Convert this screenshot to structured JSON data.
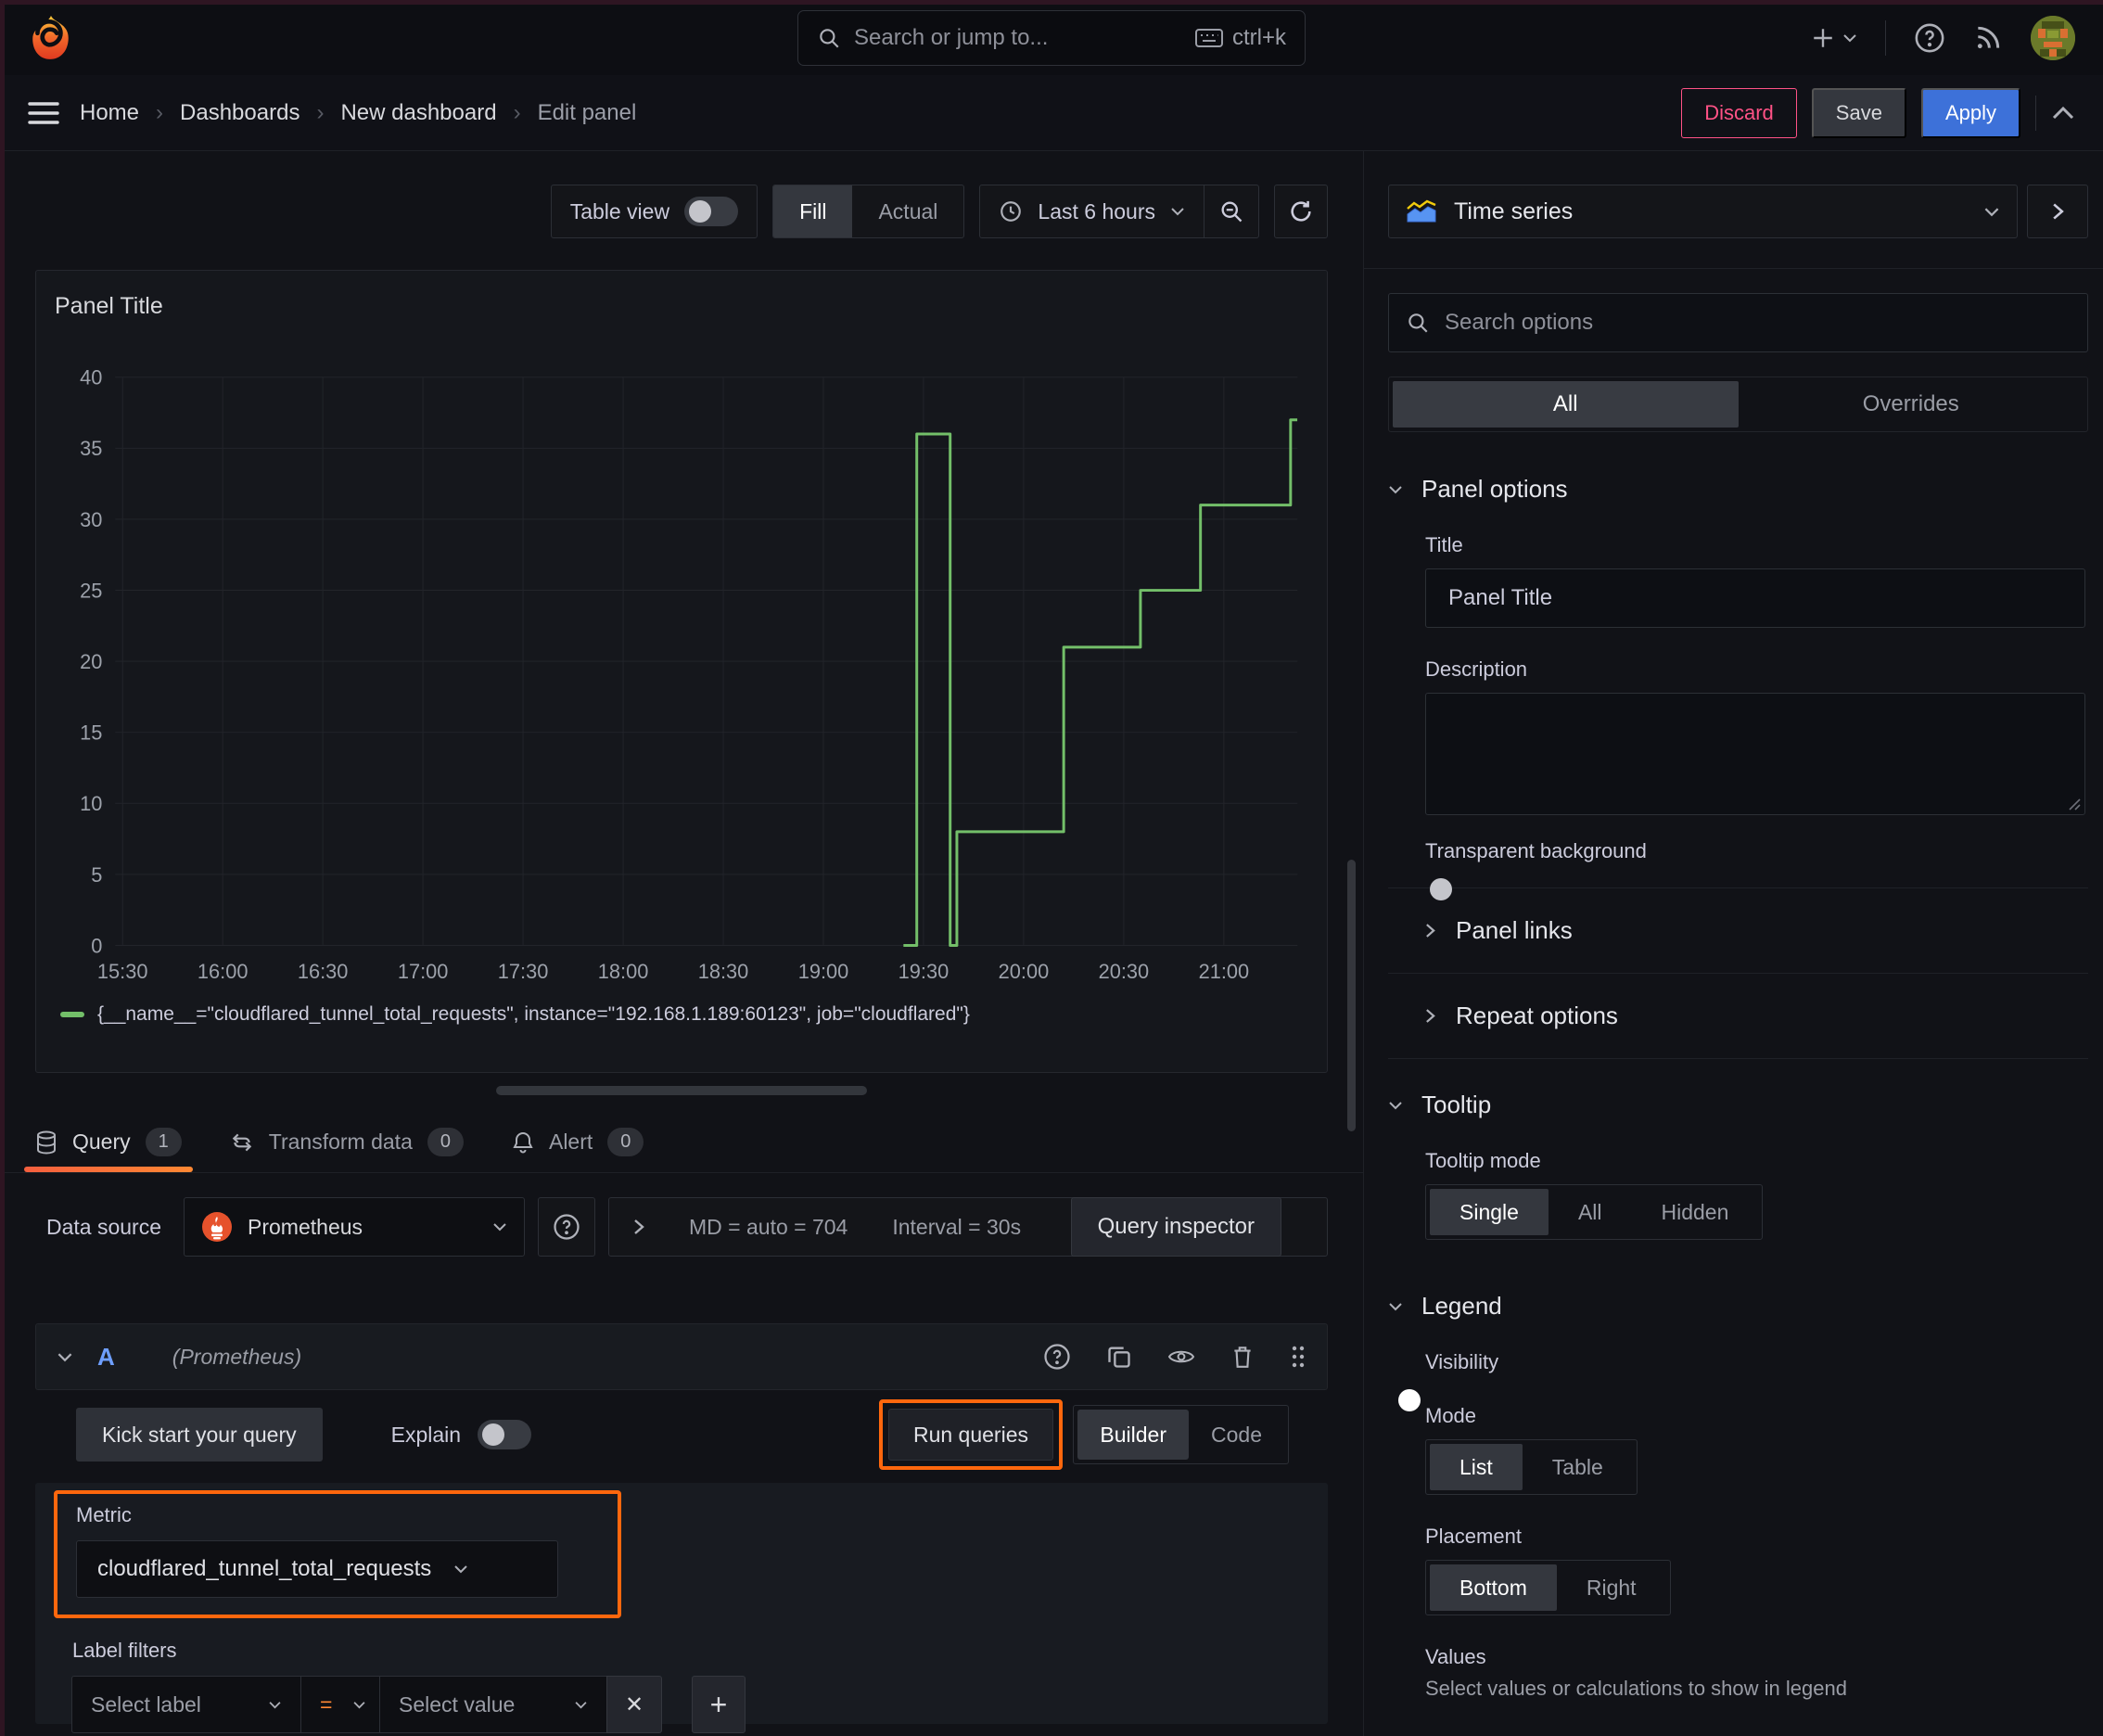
{
  "topbar": {
    "search_placeholder": "Search or jump to...",
    "search_shortcut": "ctrl+k"
  },
  "breadcrumb": {
    "items": [
      "Home",
      "Dashboards",
      "New dashboard",
      "Edit panel"
    ],
    "discard_label": "Discard",
    "save_label": "Save",
    "apply_label": "Apply"
  },
  "panel_toolbar": {
    "table_view_label": "Table view",
    "fill_label": "Fill",
    "actual_label": "Actual",
    "time_range_label": "Last 6 hours"
  },
  "chart_data": {
    "type": "line",
    "line_style": "step",
    "title": "Panel Title",
    "xlabel": "",
    "ylabel": "",
    "ylim": [
      0,
      40
    ],
    "y_tick_step": 5,
    "grid": true,
    "legend_position": "bottom",
    "x_ticks": [
      "15:30",
      "16:00",
      "16:30",
      "17:00",
      "17:30",
      "18:00",
      "18:30",
      "19:00",
      "19:30",
      "20:00",
      "20:30",
      "21:00"
    ],
    "series": [
      {
        "name": "{__name__=\"cloudflared_tunnel_total_requests\", instance=\"192.168.1.189:60123\", job=\"cloudflared\"}",
        "color": "#73bf69",
        "points": [
          {
            "t": "19:24",
            "v": 0
          },
          {
            "t": "19:28",
            "v": 0
          },
          {
            "t": "19:28",
            "v": 36
          },
          {
            "t": "19:38",
            "v": 36
          },
          {
            "t": "19:38",
            "v": 0
          },
          {
            "t": "19:40",
            "v": 0
          },
          {
            "t": "19:40",
            "v": 8
          },
          {
            "t": "20:12",
            "v": 8
          },
          {
            "t": "20:12",
            "v": 21
          },
          {
            "t": "20:35",
            "v": 21
          },
          {
            "t": "20:35",
            "v": 25
          },
          {
            "t": "20:53",
            "v": 25
          },
          {
            "t": "20:53",
            "v": 31
          },
          {
            "t": "21:20",
            "v": 31
          },
          {
            "t": "21:20",
            "v": 37
          },
          {
            "t": "21:22",
            "v": 37
          }
        ]
      }
    ]
  },
  "tabs": {
    "query_label": "Query",
    "query_count": "1",
    "transform_label": "Transform data",
    "transform_count": "0",
    "alert_label": "Alert",
    "alert_count": "0"
  },
  "datasource": {
    "label": "Data source",
    "name": "Prometheus",
    "max_data_points": "MD = auto = 704",
    "interval": "Interval = 30s",
    "inspector_label": "Query inspector"
  },
  "query_row": {
    "ref_id": "A",
    "datasource_hint": "(Prometheus)"
  },
  "query_toolbar": {
    "kickstart_label": "Kick start your query",
    "explain_label": "Explain",
    "run_label": "Run queries",
    "builder_label": "Builder",
    "code_label": "Code"
  },
  "editor": {
    "metric_label": "Metric",
    "metric_value": "cloudflared_tunnel_total_requests",
    "label_filters_label": "Label filters",
    "select_label_placeholder": "Select label",
    "operator": "=",
    "select_value_placeholder": "Select value",
    "remove_label": "x",
    "add_label": "+"
  },
  "sidebar": {
    "viz_name": "Time series",
    "search_placeholder": "Search options",
    "tab_all": "All",
    "tab_overrides": "Overrides",
    "panel_options": {
      "title": "Panel options",
      "title_label": "Title",
      "title_value": "Panel Title",
      "description_label": "Description",
      "description_value": "",
      "transparent_label": "Transparent background"
    },
    "links_label": "Panel links",
    "repeat_label": "Repeat options",
    "tooltip": {
      "title": "Tooltip",
      "mode_label": "Tooltip mode",
      "modes": [
        "Single",
        "All",
        "Hidden"
      ],
      "selected_mode": "Single"
    },
    "legend": {
      "title": "Legend",
      "visibility_label": "Visibility",
      "mode_label": "Mode",
      "modes": [
        "List",
        "Table"
      ],
      "selected_mode": "List",
      "placement_label": "Placement",
      "placements": [
        "Bottom",
        "Right"
      ],
      "selected_placement": "Bottom",
      "values_label": "Values",
      "values_help": "Select values or calculations to show in legend"
    }
  },
  "colors": {
    "accent_orange": "#ff670d",
    "tab_gradient": [
      "#f55f3e",
      "#ff8833"
    ],
    "primary_blue": "#3d71d9",
    "destructive_pink": "#ff5286",
    "series_green": "#73bf69",
    "background": "#111217"
  }
}
